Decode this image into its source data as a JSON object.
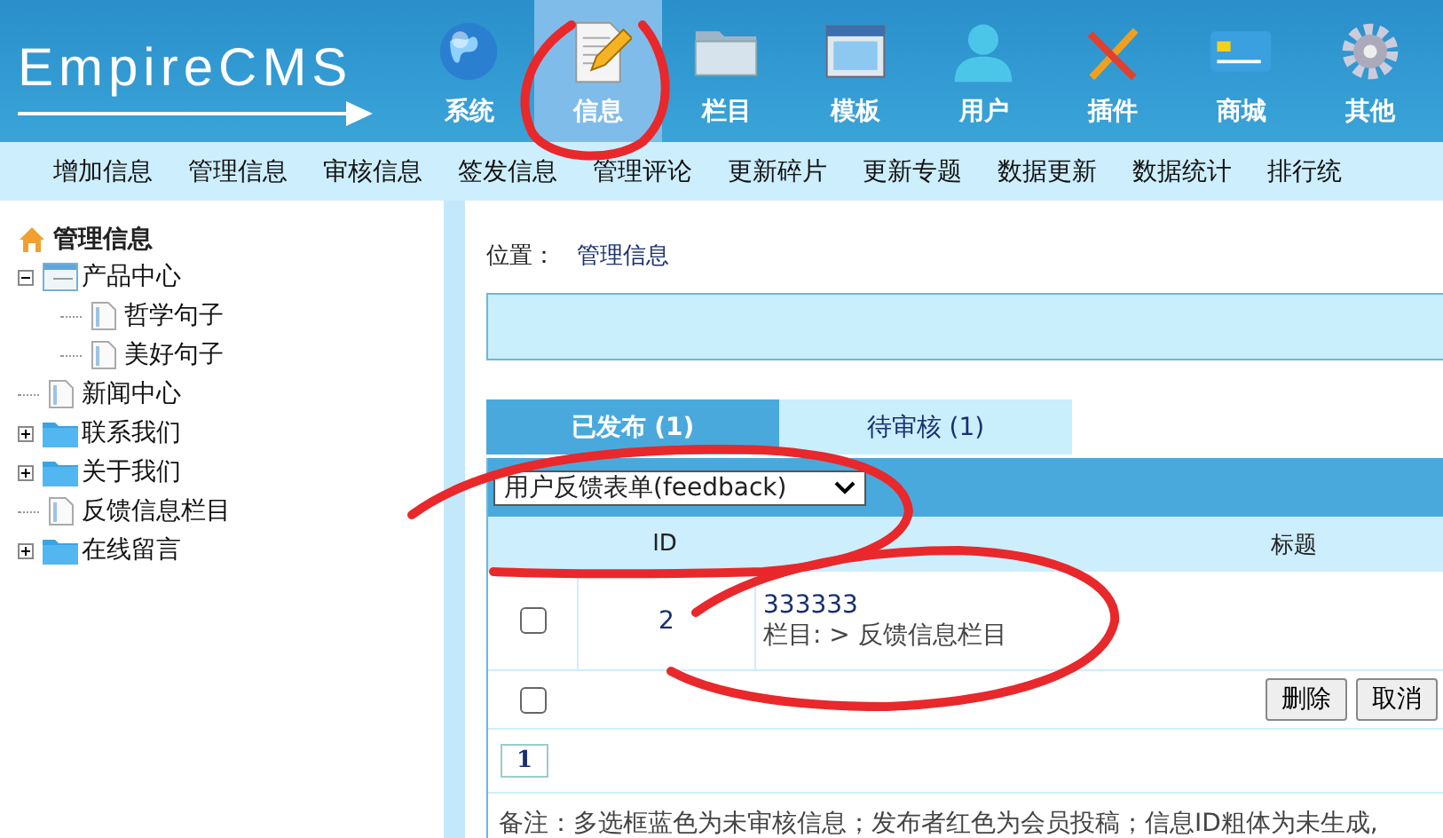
{
  "header": {
    "logo": "EmpireCMS",
    "nav": [
      {
        "label": "系统",
        "selected": false
      },
      {
        "label": "信息",
        "selected": true
      },
      {
        "label": "栏目",
        "selected": false
      },
      {
        "label": "模板",
        "selected": false
      },
      {
        "label": "用户",
        "selected": false
      },
      {
        "label": "插件",
        "selected": false
      },
      {
        "label": "商城",
        "selected": false
      },
      {
        "label": "其他",
        "selected": false
      }
    ]
  },
  "submenu": [
    "增加信息",
    "管理信息",
    "审核信息",
    "签发信息",
    "管理评论",
    "更新碎片",
    "更新专题",
    "数据更新",
    "数据统计",
    "排行统"
  ],
  "sidebar": {
    "title": "管理信息",
    "tree": [
      {
        "label": "产品中心",
        "kind": "list",
        "expanded": true,
        "children": [
          {
            "label": "哲学句子",
            "kind": "page"
          },
          {
            "label": "美好句子",
            "kind": "page"
          }
        ]
      },
      {
        "label": "新闻中心",
        "kind": "page"
      },
      {
        "label": "联系我们",
        "kind": "folder",
        "expanded": false
      },
      {
        "label": "关于我们",
        "kind": "folder",
        "expanded": false
      },
      {
        "label": "反馈信息栏目",
        "kind": "page"
      },
      {
        "label": "在线留言",
        "kind": "folder",
        "expanded": false
      }
    ]
  },
  "breadcrumb": {
    "label": "位置：",
    "path": "管理信息"
  },
  "tabs": [
    {
      "label": "已发布 (1)",
      "selected": true
    },
    {
      "label": "待审核 (1)",
      "selected": false
    }
  ],
  "form_select": {
    "value": "用户反馈表单(feedback)"
  },
  "table": {
    "columns": [
      "ID",
      "标题"
    ],
    "rows": [
      {
        "checked": false,
        "id": "2",
        "title": "333333",
        "category": "栏目: > 反馈信息栏目"
      }
    ]
  },
  "select_all": {
    "checked": false
  },
  "buttons": [
    "删除",
    "取消"
  ],
  "pagination": [
    "1"
  ],
  "note": "备注：多选框蓝色为未审核信息；发布者红色为会员投稿；信息ID粗体为未生成,"
}
